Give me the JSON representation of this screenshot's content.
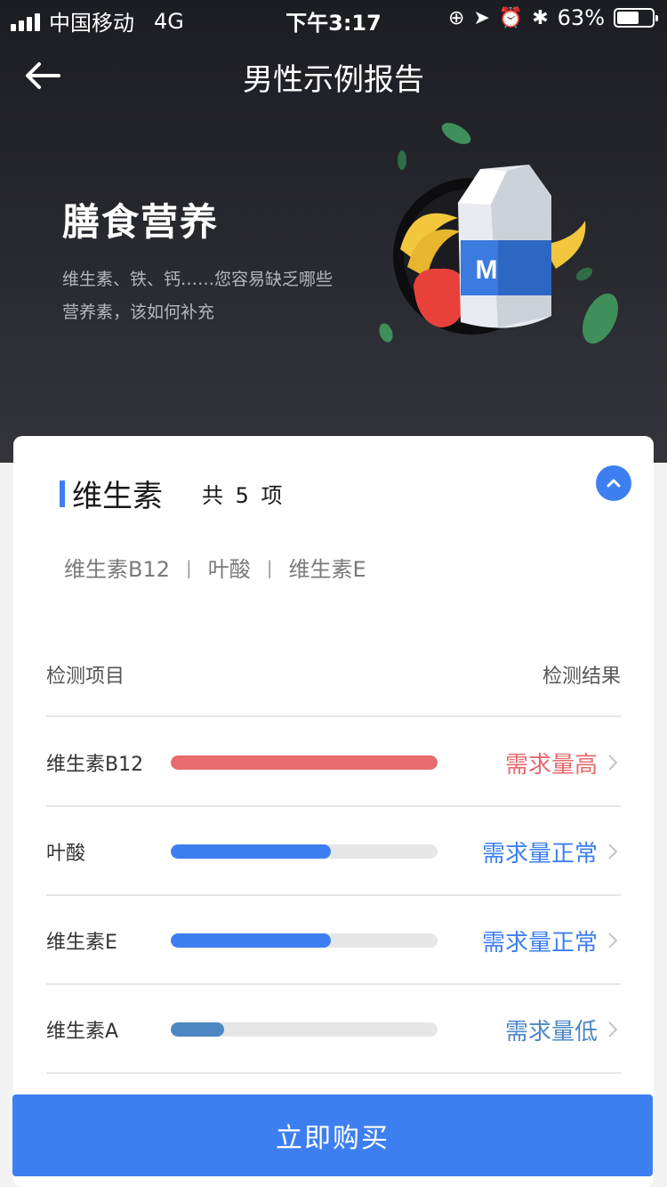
{
  "status_bar": {
    "carrier": "中国移动",
    "network": "4G",
    "time": "下午3:17",
    "battery_percent": "63%",
    "battery_level": 0.63
  },
  "nav": {
    "title": "男性示例报告",
    "back_icon": "arrow-left-icon"
  },
  "hero": {
    "title": "膳食营养",
    "description": "维生素、铁、钙……您容易缺乏哪些营养素，该如何补充",
    "milk_letter": "M"
  },
  "section": {
    "title": "维生素",
    "count": "共 5 项",
    "tags": [
      "维生素B12",
      "叶酸",
      "维生素E"
    ],
    "tag_separator": "|"
  },
  "table": {
    "header_item": "检测项目",
    "header_result": "检测结果",
    "rows": [
      {
        "name": "维生素B12",
        "result": "需求量高",
        "level": 1.0,
        "color": "#e66a6e"
      },
      {
        "name": "叶酸",
        "result": "需求量正常",
        "level": 0.6,
        "color": "#3d7ff0"
      },
      {
        "name": "维生素E",
        "result": "需求量正常",
        "level": 0.6,
        "color": "#3d7ff0"
      },
      {
        "name": "维生素A",
        "result": "需求量低",
        "level": 0.2,
        "color": "#4e86c4"
      }
    ]
  },
  "buy_button": "立即购买",
  "colors": {
    "accent": "#3d7ff0",
    "high": "#e66a6e",
    "normal": "#3d7ff0",
    "low": "#4e86c4"
  }
}
